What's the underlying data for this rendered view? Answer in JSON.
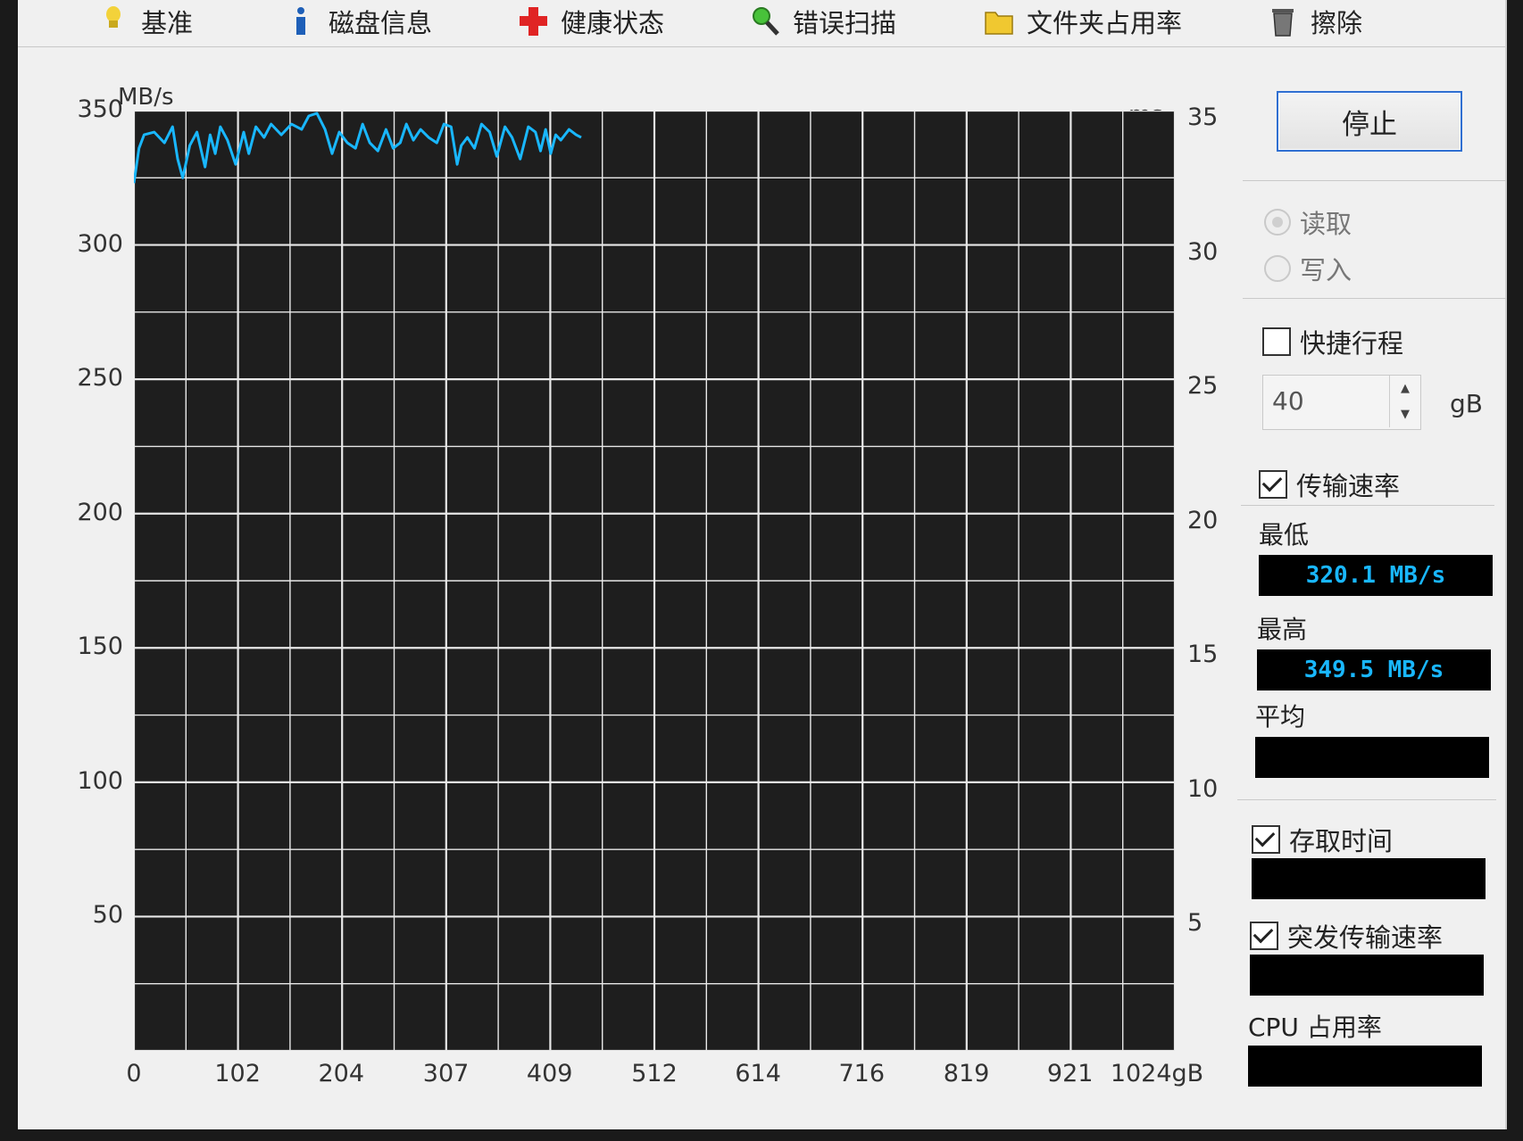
{
  "tabs": [
    {
      "label": "基准",
      "icon": "lightbulb-icon"
    },
    {
      "label": "磁盘信息",
      "icon": "info-icon"
    },
    {
      "label": "健康状态",
      "icon": "red-cross-icon"
    },
    {
      "label": "错误扫描",
      "icon": "magnifier-icon"
    },
    {
      "label": "文件夹占用率",
      "icon": "folder-icon"
    },
    {
      "label": "擦除",
      "icon": "trash-icon"
    }
  ],
  "colors": {
    "plot_background": "#1e1e1e",
    "grid": "#e8e8e8",
    "series": "#19b7ff",
    "readout_text": "#19b7ff"
  },
  "chart_data": {
    "type": "line",
    "y_unit_left": "MB/s",
    "y_unit_right": "ms",
    "x_unit": "gB",
    "ylim": [
      0,
      350
    ],
    "y2lim": [
      0,
      35
    ],
    "xlim": [
      0,
      1024
    ],
    "y_ticks": [
      "350",
      "300",
      "250",
      "200",
      "150",
      "100",
      "50"
    ],
    "y2_ticks": [
      "35",
      "30",
      "25",
      "20",
      "15",
      "10",
      "5"
    ],
    "x_ticks": [
      "0",
      "102",
      "204",
      "307",
      "409",
      "512",
      "614",
      "716",
      "819",
      "921",
      "1024gB"
    ],
    "grid": "on",
    "series": [
      {
        "x": [
          0,
          5,
          10,
          20,
          30,
          38,
          43,
          48,
          55,
          62,
          70,
          75,
          80,
          85,
          92,
          100,
          108,
          113,
          120,
          128,
          135,
          145,
          155,
          165,
          172,
          180,
          188,
          195,
          202,
          210,
          218,
          225,
          232,
          240,
          248,
          255,
          262,
          268,
          275,
          282,
          290,
          298,
          305,
          312,
          318,
          322,
          328,
          335,
          342,
          350,
          357,
          365,
          372,
          380,
          388,
          395,
          400,
          405,
          410,
          415,
          420,
          428,
          435,
          440
        ],
        "y": [
          323,
          336,
          341,
          342,
          338,
          344,
          332,
          325,
          337,
          342,
          329,
          341,
          334,
          344,
          339,
          330,
          342,
          334,
          344,
          340,
          345,
          341,
          345,
          343,
          348,
          349,
          343,
          334,
          342,
          338,
          336,
          345,
          338,
          335,
          343,
          336,
          338,
          345,
          339,
          343,
          340,
          338,
          345,
          344,
          330,
          337,
          340,
          336,
          345,
          342,
          333,
          344,
          340,
          332,
          344,
          342,
          335,
          343,
          334,
          341,
          339,
          343,
          341,
          340
        ]
      }
    ]
  },
  "stop_button": "停止",
  "mode": {
    "read": "读取",
    "write": "写入",
    "selected": "read"
  },
  "quick_pass": {
    "label": "快捷行程",
    "checked": false,
    "value": "40",
    "unit": "gB"
  },
  "transfer_rate": {
    "label": "传输速率",
    "checked": true
  },
  "stats": {
    "min_label": "最低",
    "min_value": "320.1 MB/s",
    "max_label": "最高",
    "max_value": "349.5 MB/s",
    "avg_label": "平均",
    "avg_value": ""
  },
  "access_time": {
    "label": "存取时间",
    "checked": true,
    "value": ""
  },
  "burst_rate": {
    "label": "突发传输速率",
    "checked": true,
    "value": ""
  },
  "cpu": {
    "label": "CPU 占用率",
    "value": ""
  }
}
